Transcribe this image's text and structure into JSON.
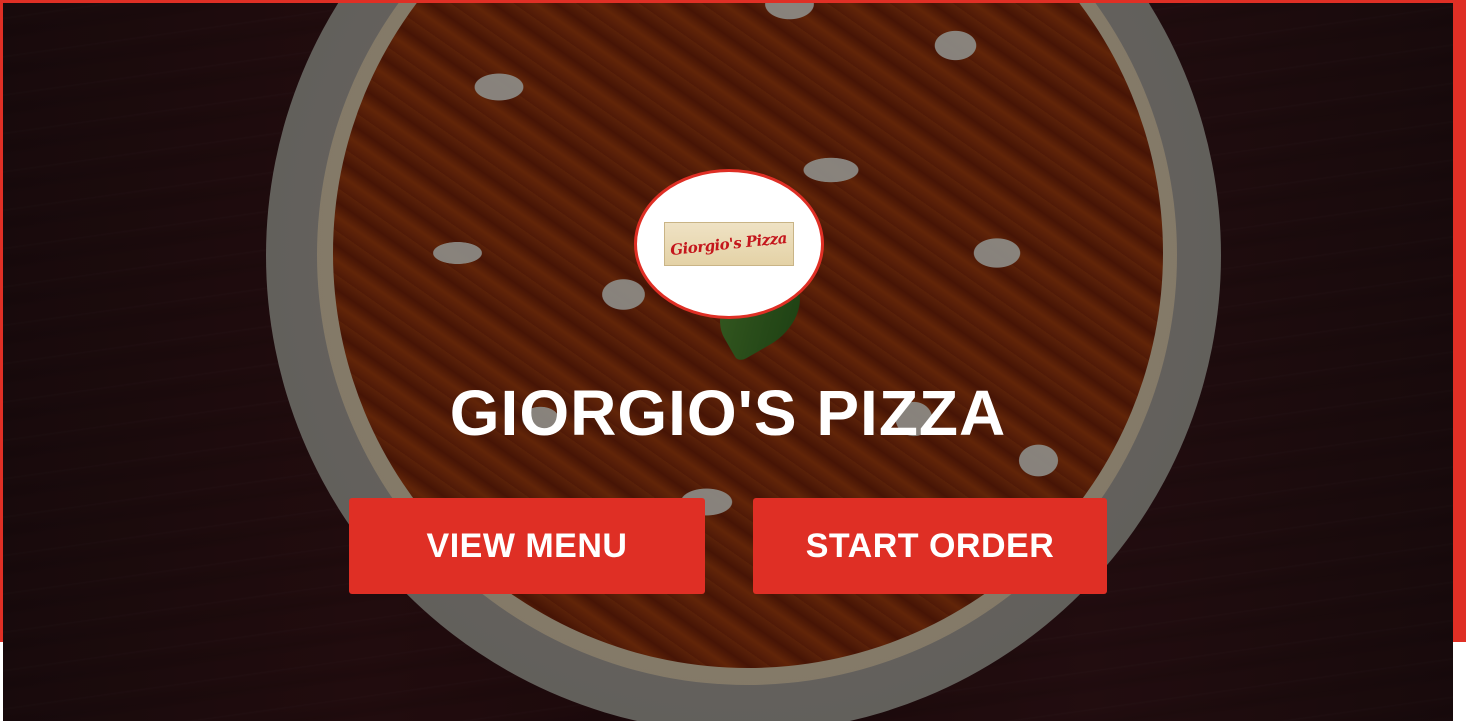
{
  "hero": {
    "logo_text": "Giorgio's Pizza",
    "title": "GIORGIO'S PIZZA"
  },
  "actions": {
    "view_menu_label": "VIEW MENU",
    "start_order_label": "START ORDER"
  },
  "colors": {
    "accent": "#df2f25",
    "title_text": "#ffffff",
    "background_wood": "#2f1013"
  }
}
